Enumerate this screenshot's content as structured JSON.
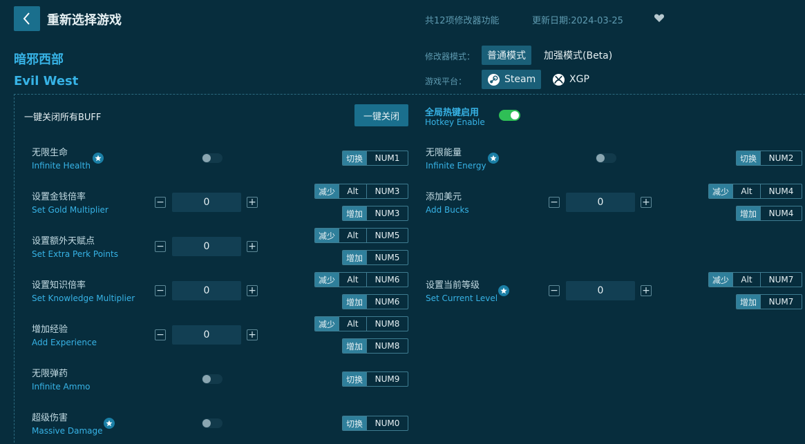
{
  "header": {
    "title": "重新选择游戏",
    "feature_count": "共12项修改器功能",
    "update_date": "更新日期:2024-03-25"
  },
  "game": {
    "name_cn": "暗邪西部",
    "name_en": "Evil West"
  },
  "mode": {
    "label": "修改器模式：",
    "normal": "普通模式",
    "enhanced": "加强模式(Beta)"
  },
  "platform": {
    "label": "游戏平台：",
    "steam": "Steam",
    "xgp": "XGP"
  },
  "global": {
    "close_all_label": "一键关闭所有BUFF",
    "close_all_button": "一键关闭",
    "hotkey_cn": "全局热键启用",
    "hotkey_en": "Hotkey Enable"
  },
  "labels": {
    "toggle": "切换",
    "decrease": "减少",
    "increase": "增加",
    "alt": "Alt"
  },
  "features": {
    "infinite_health": {
      "cn": "无限生命",
      "en": "Infinite Health",
      "key": "NUM1"
    },
    "infinite_energy": {
      "cn": "无限能量",
      "en": "Infinite Energy",
      "key": "NUM2"
    },
    "gold_multiplier": {
      "cn": "设置金钱倍率",
      "en": "Set Gold Multiplier",
      "value": "0",
      "dec_key": "NUM3",
      "inc_key": "NUM3"
    },
    "add_bucks": {
      "cn": "添加美元",
      "en": "Add Bucks",
      "value": "0",
      "dec_key": "NUM4",
      "inc_key": "NUM4"
    },
    "extra_perk": {
      "cn": "设置额外天赋点",
      "en": "Set Extra Perk Points",
      "value": "0",
      "dec_key": "NUM5",
      "inc_key": "NUM5"
    },
    "knowledge_multiplier": {
      "cn": "设置知识倍率",
      "en": "Set Knowledge Multiplier",
      "value": "0",
      "dec_key": "NUM6",
      "inc_key": "NUM6"
    },
    "current_level": {
      "cn": "设置当前等级",
      "en": "Set Current Level",
      "value": "0",
      "dec_key": "NUM7",
      "inc_key": "NUM7"
    },
    "add_experience": {
      "cn": "增加经验",
      "en": "Add Experience",
      "value": "0",
      "dec_key": "NUM8",
      "inc_key": "NUM8"
    },
    "infinite_ammo": {
      "cn": "无限弹药",
      "en": "Infinite Ammo",
      "key": "NUM9"
    },
    "massive_damage": {
      "cn": "超级伤害",
      "en": "Massive Damage",
      "key": "NUM0"
    }
  }
}
